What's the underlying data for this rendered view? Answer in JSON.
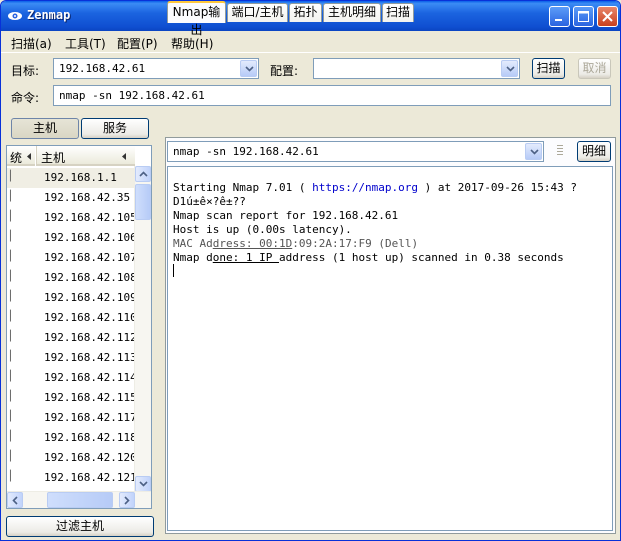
{
  "window": {
    "title": "Zenmap"
  },
  "menu": {
    "items": [
      "扫描(a)",
      "工具(T)",
      "配置(P)",
      "帮助(H)"
    ]
  },
  "target": {
    "label": "目标:",
    "value": "192.168.42.61"
  },
  "profile": {
    "label": "配置:",
    "value": ""
  },
  "actions": {
    "scan": "扫描",
    "cancel": "取消"
  },
  "command": {
    "label": "命令:",
    "value": "nmap -sn 192.168.42.61"
  },
  "left": {
    "hosts_button": "主机",
    "services_button": "服务",
    "col_os": "统",
    "col_host": "主机",
    "hosts": [
      "192.168.1.1",
      "192.168.42.35",
      "192.168.42.105",
      "192.168.42.106",
      "192.168.42.107",
      "192.168.42.108",
      "192.168.42.109",
      "192.168.42.110",
      "192.168.42.112",
      "192.168.42.113",
      "192.168.42.114",
      "192.168.42.115",
      "192.168.42.117",
      "192.168.42.118",
      "192.168.42.120",
      "192.168.42.121"
    ],
    "filter_button": "过滤主机"
  },
  "tabs": [
    "Nmap输出",
    "端口/主机",
    "拓扑",
    "主机明细",
    "扫描"
  ],
  "output": {
    "selector_value": "nmap -sn 192.168.42.61",
    "details_button": "明细",
    "line1_pre": "Starting Nmap 7.01 ( ",
    "line1_link": "https://nmap.org",
    "line1_post": " ) at 2017-09-26 15:43 ?",
    "line2": "D1ú±ê×?ê±??",
    "line3": "Nmap scan report for 192.168.42.61",
    "line4": "Host is up (0.00s latency).",
    "line5_pre": "MAC Ad",
    "line5_mid": "dress: 00:1D",
    "line5_post": ":09:2A:17:F9 (Dell)",
    "line6_pre": "Nmap d",
    "line6_mid": "one: 1 IP ",
    "line6_post": "address (1 host up) scanned in 0.38 seconds"
  },
  "colors": {
    "titlebar": "#0f4fd1",
    "active_tab_accent": "#ffc83c",
    "link": "#0000cc"
  }
}
